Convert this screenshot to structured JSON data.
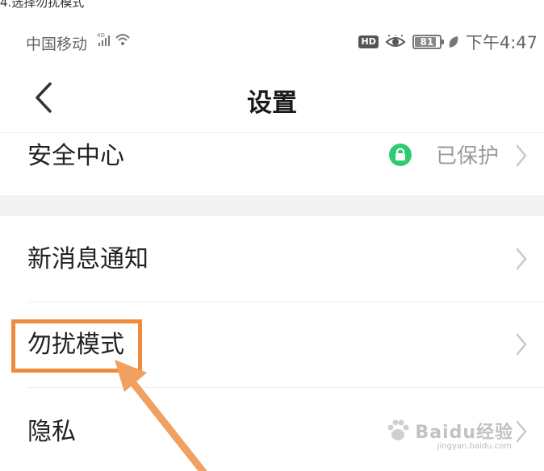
{
  "caption": "4.选择勿扰模式",
  "status_bar": {
    "carrier": "中国移动",
    "network": "4G",
    "hd_badge": "HD",
    "battery": "81",
    "battery_level": 0.81,
    "time": "下午4:47"
  },
  "header": {
    "title": "设置",
    "back_icon": "chevron-left-icon"
  },
  "rows": [
    {
      "label": "安全中心",
      "value": "已保护",
      "status_color": "#2ecc71"
    },
    {
      "label": "新消息通知"
    },
    {
      "label": "勿扰模式",
      "highlighted": true
    },
    {
      "label": "隐私"
    }
  ],
  "annotation": {
    "highlight_color": "#f08a3c"
  },
  "watermark": {
    "brand": "Baidu经验",
    "site": "jingyan.baidu.com"
  },
  "colors": {
    "accent_orange": "#f08a3c",
    "status_green": "#2ecc71",
    "secondary_text": "#9a9a9a",
    "section_gap": "#f3f3f3"
  }
}
